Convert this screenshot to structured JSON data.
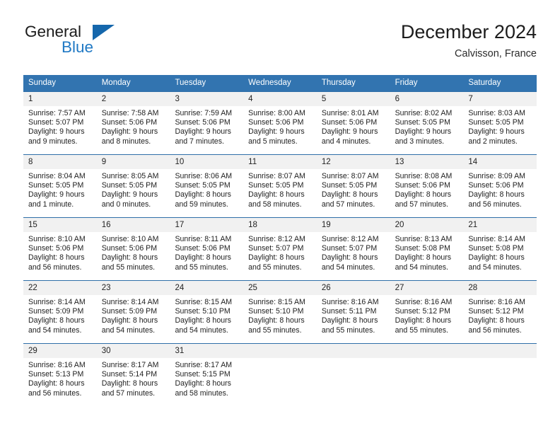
{
  "brand": {
    "name_part1": "General",
    "name_part2": "Blue",
    "mark": "triangle-logo",
    "color_dark": "#1b1b1b",
    "color_blue": "#2079c4",
    "mark_color": "#1567ac"
  },
  "header": {
    "title": "December 2024",
    "subtitle": "Calvisson, France"
  },
  "theme": {
    "header_blue": "#3274b0",
    "row_gray": "#f1f1f1",
    "rule_blue": "#2f6fa8"
  },
  "weekdays": [
    "Sunday",
    "Monday",
    "Tuesday",
    "Wednesday",
    "Thursday",
    "Friday",
    "Saturday"
  ],
  "weeks": [
    {
      "days": [
        {
          "num": "1",
          "sunrise": "Sunrise: 7:57 AM",
          "sunset": "Sunset: 5:07 PM",
          "daylight1": "Daylight: 9 hours",
          "daylight2": "and 9 minutes."
        },
        {
          "num": "2",
          "sunrise": "Sunrise: 7:58 AM",
          "sunset": "Sunset: 5:06 PM",
          "daylight1": "Daylight: 9 hours",
          "daylight2": "and 8 minutes."
        },
        {
          "num": "3",
          "sunrise": "Sunrise: 7:59 AM",
          "sunset": "Sunset: 5:06 PM",
          "daylight1": "Daylight: 9 hours",
          "daylight2": "and 7 minutes."
        },
        {
          "num": "4",
          "sunrise": "Sunrise: 8:00 AM",
          "sunset": "Sunset: 5:06 PM",
          "daylight1": "Daylight: 9 hours",
          "daylight2": "and 5 minutes."
        },
        {
          "num": "5",
          "sunrise": "Sunrise: 8:01 AM",
          "sunset": "Sunset: 5:06 PM",
          "daylight1": "Daylight: 9 hours",
          "daylight2": "and 4 minutes."
        },
        {
          "num": "6",
          "sunrise": "Sunrise: 8:02 AM",
          "sunset": "Sunset: 5:05 PM",
          "daylight1": "Daylight: 9 hours",
          "daylight2": "and 3 minutes."
        },
        {
          "num": "7",
          "sunrise": "Sunrise: 8:03 AM",
          "sunset": "Sunset: 5:05 PM",
          "daylight1": "Daylight: 9 hours",
          "daylight2": "and 2 minutes."
        }
      ]
    },
    {
      "days": [
        {
          "num": "8",
          "sunrise": "Sunrise: 8:04 AM",
          "sunset": "Sunset: 5:05 PM",
          "daylight1": "Daylight: 9 hours",
          "daylight2": "and 1 minute."
        },
        {
          "num": "9",
          "sunrise": "Sunrise: 8:05 AM",
          "sunset": "Sunset: 5:05 PM",
          "daylight1": "Daylight: 9 hours",
          "daylight2": "and 0 minutes."
        },
        {
          "num": "10",
          "sunrise": "Sunrise: 8:06 AM",
          "sunset": "Sunset: 5:05 PM",
          "daylight1": "Daylight: 8 hours",
          "daylight2": "and 59 minutes."
        },
        {
          "num": "11",
          "sunrise": "Sunrise: 8:07 AM",
          "sunset": "Sunset: 5:05 PM",
          "daylight1": "Daylight: 8 hours",
          "daylight2": "and 58 minutes."
        },
        {
          "num": "12",
          "sunrise": "Sunrise: 8:07 AM",
          "sunset": "Sunset: 5:05 PM",
          "daylight1": "Daylight: 8 hours",
          "daylight2": "and 57 minutes."
        },
        {
          "num": "13",
          "sunrise": "Sunrise: 8:08 AM",
          "sunset": "Sunset: 5:06 PM",
          "daylight1": "Daylight: 8 hours",
          "daylight2": "and 57 minutes."
        },
        {
          "num": "14",
          "sunrise": "Sunrise: 8:09 AM",
          "sunset": "Sunset: 5:06 PM",
          "daylight1": "Daylight: 8 hours",
          "daylight2": "and 56 minutes."
        }
      ]
    },
    {
      "days": [
        {
          "num": "15",
          "sunrise": "Sunrise: 8:10 AM",
          "sunset": "Sunset: 5:06 PM",
          "daylight1": "Daylight: 8 hours",
          "daylight2": "and 56 minutes."
        },
        {
          "num": "16",
          "sunrise": "Sunrise: 8:10 AM",
          "sunset": "Sunset: 5:06 PM",
          "daylight1": "Daylight: 8 hours",
          "daylight2": "and 55 minutes."
        },
        {
          "num": "17",
          "sunrise": "Sunrise: 8:11 AM",
          "sunset": "Sunset: 5:06 PM",
          "daylight1": "Daylight: 8 hours",
          "daylight2": "and 55 minutes."
        },
        {
          "num": "18",
          "sunrise": "Sunrise: 8:12 AM",
          "sunset": "Sunset: 5:07 PM",
          "daylight1": "Daylight: 8 hours",
          "daylight2": "and 55 minutes."
        },
        {
          "num": "19",
          "sunrise": "Sunrise: 8:12 AM",
          "sunset": "Sunset: 5:07 PM",
          "daylight1": "Daylight: 8 hours",
          "daylight2": "and 54 minutes."
        },
        {
          "num": "20",
          "sunrise": "Sunrise: 8:13 AM",
          "sunset": "Sunset: 5:08 PM",
          "daylight1": "Daylight: 8 hours",
          "daylight2": "and 54 minutes."
        },
        {
          "num": "21",
          "sunrise": "Sunrise: 8:14 AM",
          "sunset": "Sunset: 5:08 PM",
          "daylight1": "Daylight: 8 hours",
          "daylight2": "and 54 minutes."
        }
      ]
    },
    {
      "days": [
        {
          "num": "22",
          "sunrise": "Sunrise: 8:14 AM",
          "sunset": "Sunset: 5:09 PM",
          "daylight1": "Daylight: 8 hours",
          "daylight2": "and 54 minutes."
        },
        {
          "num": "23",
          "sunrise": "Sunrise: 8:14 AM",
          "sunset": "Sunset: 5:09 PM",
          "daylight1": "Daylight: 8 hours",
          "daylight2": "and 54 minutes."
        },
        {
          "num": "24",
          "sunrise": "Sunrise: 8:15 AM",
          "sunset": "Sunset: 5:10 PM",
          "daylight1": "Daylight: 8 hours",
          "daylight2": "and 54 minutes."
        },
        {
          "num": "25",
          "sunrise": "Sunrise: 8:15 AM",
          "sunset": "Sunset: 5:10 PM",
          "daylight1": "Daylight: 8 hours",
          "daylight2": "and 55 minutes."
        },
        {
          "num": "26",
          "sunrise": "Sunrise: 8:16 AM",
          "sunset": "Sunset: 5:11 PM",
          "daylight1": "Daylight: 8 hours",
          "daylight2": "and 55 minutes."
        },
        {
          "num": "27",
          "sunrise": "Sunrise: 8:16 AM",
          "sunset": "Sunset: 5:12 PM",
          "daylight1": "Daylight: 8 hours",
          "daylight2": "and 55 minutes."
        },
        {
          "num": "28",
          "sunrise": "Sunrise: 8:16 AM",
          "sunset": "Sunset: 5:12 PM",
          "daylight1": "Daylight: 8 hours",
          "daylight2": "and 56 minutes."
        }
      ]
    },
    {
      "days": [
        {
          "num": "29",
          "sunrise": "Sunrise: 8:16 AM",
          "sunset": "Sunset: 5:13 PM",
          "daylight1": "Daylight: 8 hours",
          "daylight2": "and 56 minutes."
        },
        {
          "num": "30",
          "sunrise": "Sunrise: 8:17 AM",
          "sunset": "Sunset: 5:14 PM",
          "daylight1": "Daylight: 8 hours",
          "daylight2": "and 57 minutes."
        },
        {
          "num": "31",
          "sunrise": "Sunrise: 8:17 AM",
          "sunset": "Sunset: 5:15 PM",
          "daylight1": "Daylight: 8 hours",
          "daylight2": "and 58 minutes."
        },
        {
          "num": "",
          "sunrise": "",
          "sunset": "",
          "daylight1": "",
          "daylight2": ""
        },
        {
          "num": "",
          "sunrise": "",
          "sunset": "",
          "daylight1": "",
          "daylight2": ""
        },
        {
          "num": "",
          "sunrise": "",
          "sunset": "",
          "daylight1": "",
          "daylight2": ""
        },
        {
          "num": "",
          "sunrise": "",
          "sunset": "",
          "daylight1": "",
          "daylight2": ""
        }
      ]
    }
  ]
}
